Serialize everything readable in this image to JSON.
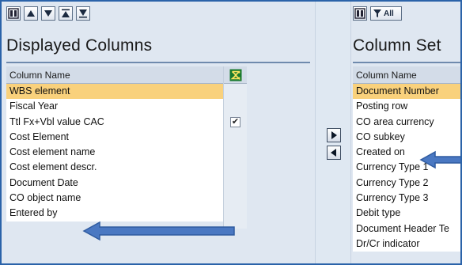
{
  "left_panel": {
    "toolbar_icons": [
      "panel-layout-icon",
      "move-up-icon",
      "move-down-icon",
      "move-top-icon",
      "move-bottom-icon"
    ],
    "title": "Displayed Columns",
    "column_header": "Column Name",
    "sum_header_icon": "sigma-icon",
    "rows": [
      {
        "label": "WBS element",
        "selected": true,
        "checked": false
      },
      {
        "label": "Fiscal Year",
        "selected": false,
        "checked": false
      },
      {
        "label": "Ttl Fx+Vbl value CAC",
        "selected": false,
        "checked": true
      },
      {
        "label": "Cost Element",
        "selected": false,
        "checked": false
      },
      {
        "label": "Cost element name",
        "selected": false,
        "checked": false
      },
      {
        "label": "Cost element descr.",
        "selected": false,
        "checked": false
      },
      {
        "label": "Document Date",
        "selected": false,
        "checked": false
      },
      {
        "label": "CO object name",
        "selected": false,
        "checked": false
      },
      {
        "label": "Entered by",
        "selected": false,
        "checked": false
      }
    ]
  },
  "right_panel": {
    "toolbar": {
      "layout_icon": "panel-layout-icon",
      "filter_label": "All",
      "filter_icon": "filter-icon"
    },
    "title": "Column Set",
    "column_header": "Column Name",
    "rows": [
      {
        "label": "Document Number",
        "selected": true
      },
      {
        "label": "Posting row",
        "selected": false
      },
      {
        "label": "CO area currency",
        "selected": false
      },
      {
        "label": "CO subkey",
        "selected": false
      },
      {
        "label": "Created on",
        "selected": false
      },
      {
        "label": "Currency Type 1",
        "selected": false
      },
      {
        "label": "Currency Type 2",
        "selected": false
      },
      {
        "label": "Currency Type 3",
        "selected": false
      },
      {
        "label": "Debit type",
        "selected": false
      },
      {
        "label": "Document Header Te",
        "selected": false
      },
      {
        "label": "Dr/Cr indicator",
        "selected": false
      }
    ]
  },
  "middle": {
    "buttons": [
      "move-right-icon",
      "move-left-icon"
    ]
  },
  "colors": {
    "selection": "#f9d17c",
    "frame": "#2b63a9",
    "annotation_arrow": "#4a78c2",
    "panel_bg": "#dfe7f1"
  }
}
